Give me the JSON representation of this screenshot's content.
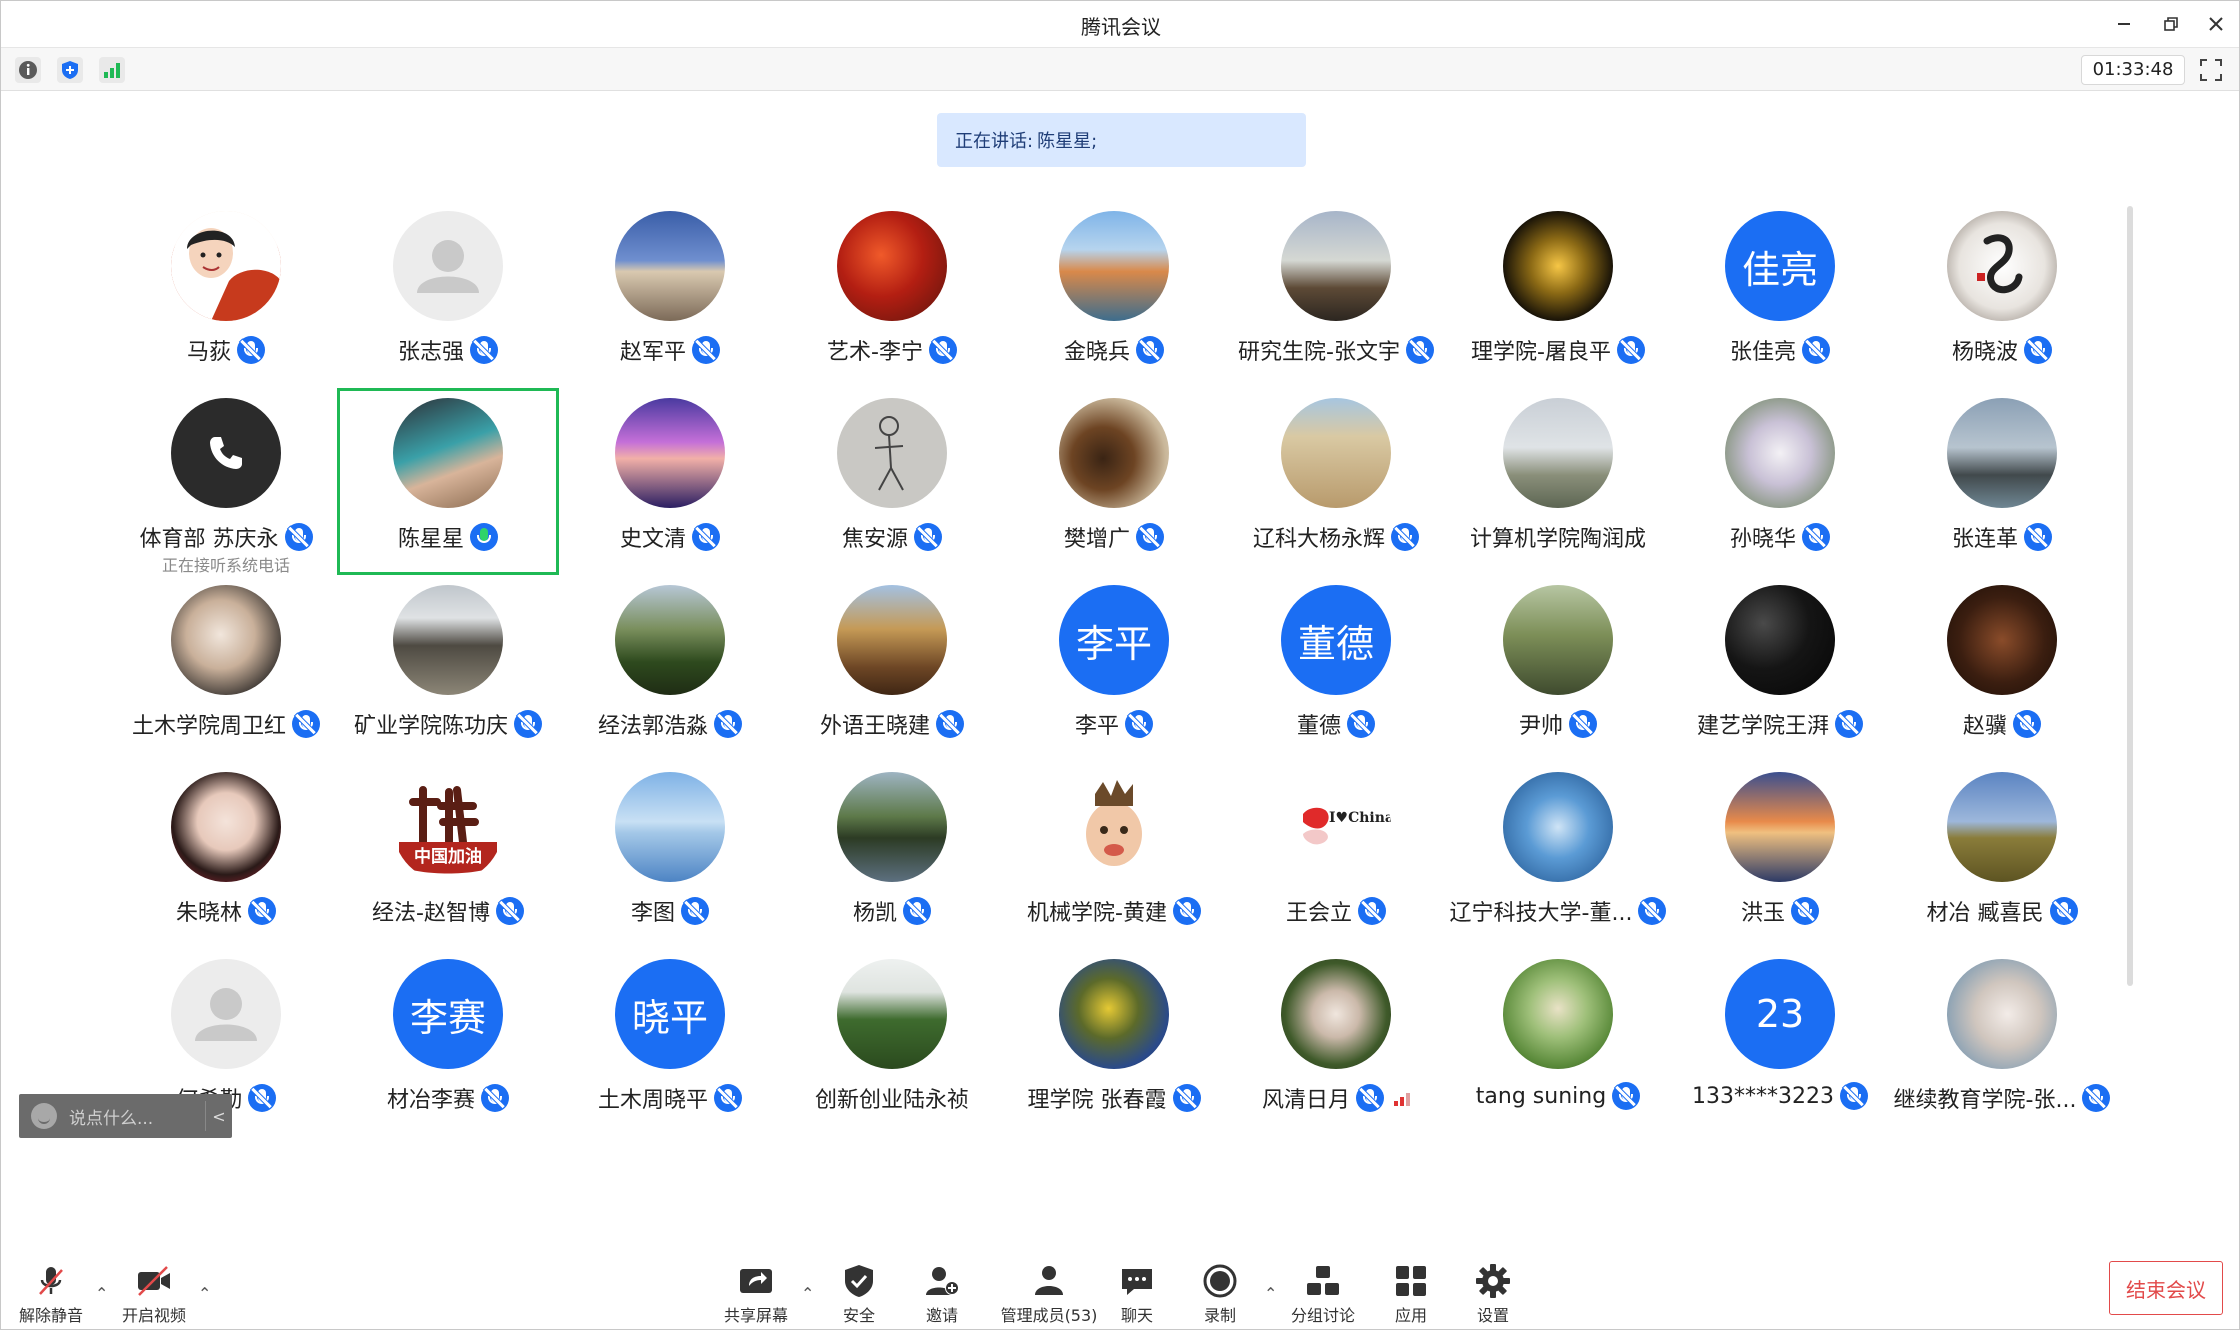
{
  "window": {
    "title": "腾讯会议"
  },
  "top": {
    "timer": "01:33:48"
  },
  "speaking": {
    "label": "正在讲话:",
    "names": "陈星星;"
  },
  "participants": [
    {
      "name": "马荻",
      "avatar": "cartoon-man",
      "mic": "muted"
    },
    {
      "name": "张志强",
      "avatar": "default",
      "mic": "muted"
    },
    {
      "name": "赵军平",
      "avatar": "photo-temple",
      "mic": "muted"
    },
    {
      "name": "艺术-李宁",
      "avatar": "photo-red-leaves",
      "mic": "muted"
    },
    {
      "name": "金晓兵",
      "avatar": "photo-canyon",
      "mic": "muted"
    },
    {
      "name": "研究生院-张文宇",
      "avatar": "photo-rock-tree",
      "mic": "muted"
    },
    {
      "name": "理学院-屠良平",
      "avatar": "photo-night-building",
      "mic": "muted"
    },
    {
      "name": "张佳亮",
      "avatar": "text",
      "avatar_text": "佳亮",
      "mic": "muted"
    },
    {
      "name": "杨晓波",
      "avatar": "calligraphy",
      "mic": "muted"
    },
    {
      "name": "体育部 苏庆永",
      "avatar": "phone",
      "mic": "muted",
      "subtext": "正在接听系统电话"
    },
    {
      "name": "陈星星",
      "avatar": "photo-woman",
      "mic": "talking",
      "active": true
    },
    {
      "name": "史文清",
      "avatar": "photo-cyclist-sunset",
      "mic": "muted"
    },
    {
      "name": "焦安源",
      "avatar": "sketch",
      "mic": "muted"
    },
    {
      "name": "樊增广",
      "avatar": "photo-tea",
      "mic": "muted"
    },
    {
      "name": "辽科大杨永辉",
      "avatar": "photo-sand",
      "mic": "muted"
    },
    {
      "name": "计算机学院陶润成",
      "avatar": "photo-building",
      "mic": "none"
    },
    {
      "name": "孙晓华",
      "avatar": "photo-flowers",
      "mic": "muted"
    },
    {
      "name": "张连革",
      "avatar": "photo-sea-rock",
      "mic": "muted"
    },
    {
      "name": "土木学院周卫红",
      "avatar": "photo-girl",
      "mic": "muted"
    },
    {
      "name": "矿业学院陈功庆",
      "avatar": "photo-bronze",
      "mic": "muted"
    },
    {
      "name": "经法郭浩淼",
      "avatar": "photo-mountain",
      "mic": "muted"
    },
    {
      "name": "外语王晓建",
      "avatar": "photo-autumn-building",
      "mic": "muted"
    },
    {
      "name": "李平",
      "avatar": "text",
      "avatar_text": "李平",
      "mic": "muted"
    },
    {
      "name": "董德",
      "avatar": "text",
      "avatar_text": "董德",
      "mic": "muted"
    },
    {
      "name": "尹帅",
      "avatar": "photo-man-park",
      "mic": "muted"
    },
    {
      "name": "建艺学院王湃",
      "avatar": "photo-dark",
      "mic": "muted"
    },
    {
      "name": "赵骥",
      "avatar": "photo-portrait",
      "mic": "muted"
    },
    {
      "name": "朱晓林",
      "avatar": "photo-lady",
      "mic": "muted"
    },
    {
      "name": "经法-赵智博",
      "avatar": "calligraphy-red",
      "avatar_text": "中国加油",
      "mic": "muted"
    },
    {
      "name": "李图",
      "avatar": "photo-sky-lake",
      "mic": "muted"
    },
    {
      "name": "杨凯",
      "avatar": "photo-lake-trees",
      "mic": "muted"
    },
    {
      "name": "机械学院-黄建",
      "avatar": "cartoon-kid",
      "mic": "muted"
    },
    {
      "name": "王会立",
      "avatar": "china-love",
      "avatar_text": "I♥China",
      "mic": "muted"
    },
    {
      "name": "辽宁科技大学-董...",
      "avatar": "photo-ice-cubes",
      "mic": "muted"
    },
    {
      "name": "洪玉",
      "avatar": "photo-harbor-sunset",
      "mic": "muted"
    },
    {
      "name": "材冶 臧喜民",
      "avatar": "photo-field",
      "mic": "muted"
    },
    {
      "name": "何希勤",
      "avatar": "default",
      "mic": "muted"
    },
    {
      "name": "材冶李赛",
      "avatar": "text",
      "avatar_text": "李赛",
      "mic": "muted"
    },
    {
      "name": "土木周晓平",
      "avatar": "text",
      "avatar_text": "晓平",
      "mic": "muted"
    },
    {
      "name": "创新创业陆永祯",
      "avatar": "photo-forest",
      "mic": "none"
    },
    {
      "name": "理学院 张春霞",
      "avatar": "photo-yellow-flower",
      "mic": "muted"
    },
    {
      "name": "风清日月",
      "avatar": "photo-child-green",
      "mic": "muted",
      "signal": "weak"
    },
    {
      "name": "tang suning",
      "avatar": "photo-girl-green",
      "mic": "muted"
    },
    {
      "name": "133****3223",
      "avatar": "text",
      "avatar_text": "23",
      "mic": "muted"
    },
    {
      "name": "继续教育学院-张...",
      "avatar": "photo-baby-window",
      "mic": "muted"
    }
  ],
  "chat": {
    "placeholder": "说点什么..."
  },
  "bottombar": {
    "unmute": "解除静音",
    "video": "开启视频",
    "share": "共享屏幕",
    "security": "安全",
    "invite": "邀请",
    "members": "管理成员(53)",
    "chat": "聊天",
    "record": "录制",
    "breakout": "分组讨论",
    "apps": "应用",
    "settings": "设置",
    "end": "结束会议"
  },
  "colors": {
    "accent": "#1b6ef3",
    "active_border": "#1fb955",
    "end": "#e24a4a",
    "speaking_bg": "#d9e8ff"
  }
}
